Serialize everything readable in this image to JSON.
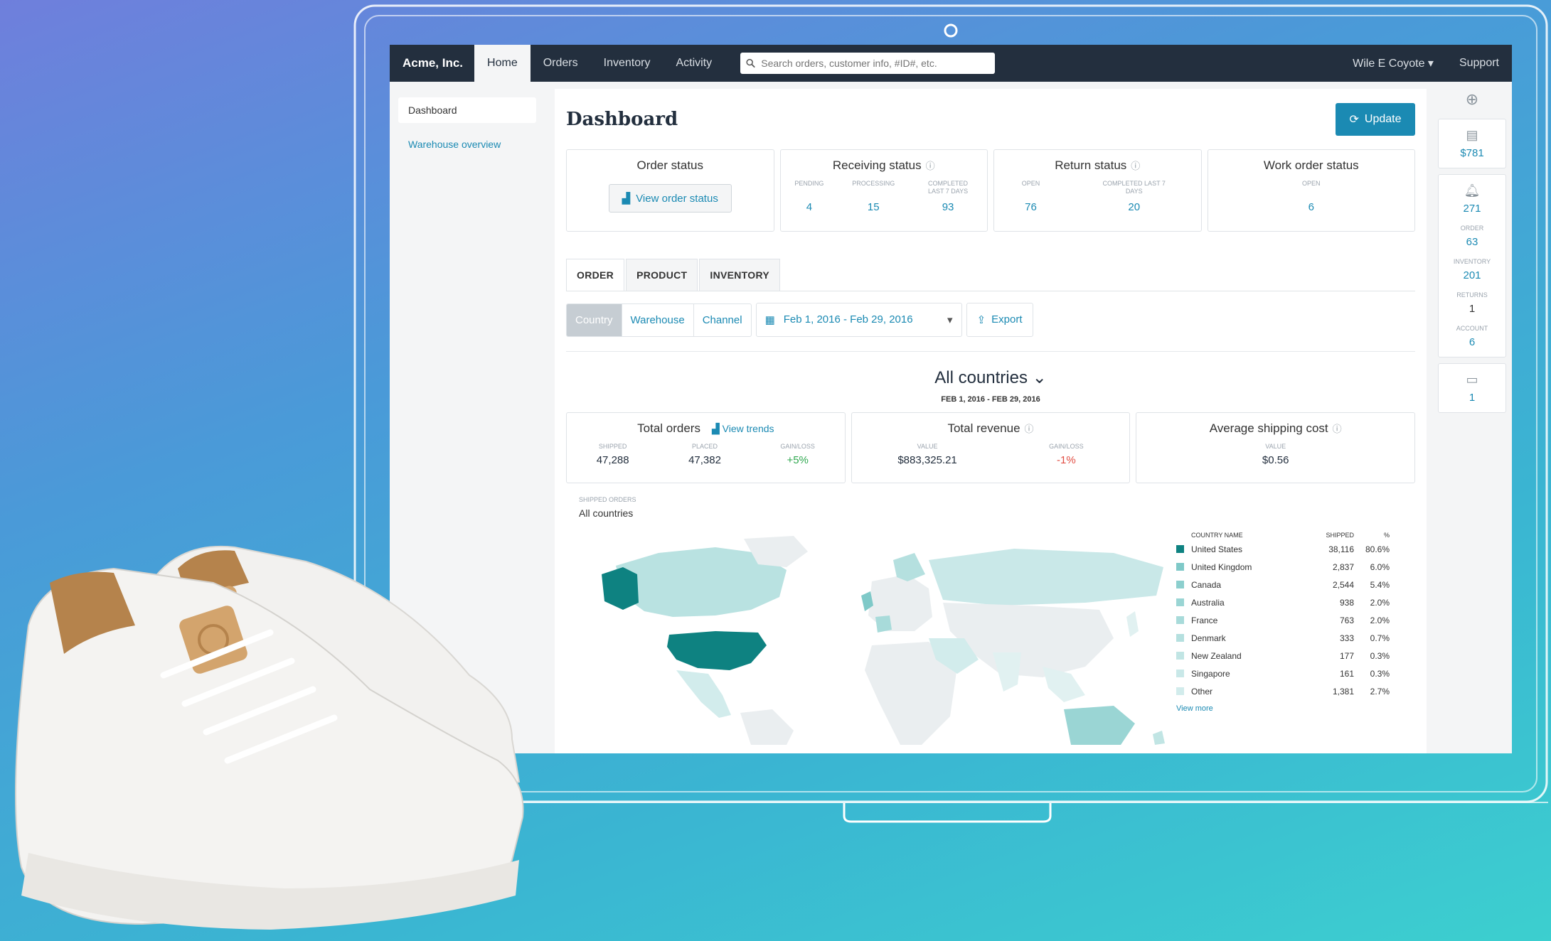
{
  "topnav": {
    "brand": "Acme, Inc.",
    "tabs": [
      "Home",
      "Orders",
      "Inventory",
      "Activity"
    ],
    "active_tab": "Home",
    "search_placeholder": "Search orders, customer info, #ID#, etc.",
    "user": "Wile E Coyote ▾",
    "support": "Support"
  },
  "sidebar": {
    "items": [
      {
        "label": "Dashboard",
        "active": true
      },
      {
        "label": "Warehouse overview",
        "active": false
      }
    ]
  },
  "page": {
    "title": "Dashboard",
    "update_label": "Update"
  },
  "status_cards": {
    "order": {
      "title": "Order status",
      "button": "View order status"
    },
    "receiving": {
      "title": "Receiving status",
      "metrics": [
        {
          "label": "Pending",
          "value": "4"
        },
        {
          "label": "Processing",
          "value": "15"
        },
        {
          "label": "Completed last 7 days",
          "value": "93"
        }
      ]
    },
    "return": {
      "title": "Return status",
      "metrics": [
        {
          "label": "Open",
          "value": "76"
        },
        {
          "label": "Completed last 7 days",
          "value": "20"
        }
      ]
    },
    "work_order": {
      "title": "Work order status",
      "metrics": [
        {
          "label": "Open",
          "value": "6"
        }
      ]
    }
  },
  "tabs": [
    "ORDER",
    "PRODUCT",
    "INVENTORY"
  ],
  "filters": {
    "segments": [
      "Country",
      "Warehouse",
      "Channel"
    ],
    "active_segment": "Country",
    "date_range": "Feb 1, 2016 - Feb 29, 2016",
    "export_label": "Export"
  },
  "country_header": {
    "selected": "All countries ⌄",
    "date_range": "FEB 1, 2016 - FEB 29, 2016"
  },
  "kpis": {
    "total_orders": {
      "title": "Total orders",
      "trend_link": "View trends",
      "metrics": [
        {
          "label": "Shipped",
          "value": "47,288",
          "tone": "neutral"
        },
        {
          "label": "Placed",
          "value": "47,382",
          "tone": "neutral"
        },
        {
          "label": "Gain/Loss",
          "value": "+5%",
          "tone": "pos"
        }
      ]
    },
    "total_revenue": {
      "title": "Total revenue",
      "metrics": [
        {
          "label": "Value",
          "value": "$883,325.21",
          "tone": "neutral"
        },
        {
          "label": "Gain/Loss",
          "value": "-1%",
          "tone": "neg"
        }
      ]
    },
    "avg_shipping": {
      "title": "Average shipping cost",
      "metrics": [
        {
          "label": "Value",
          "value": "$0.56",
          "tone": "neutral"
        }
      ]
    }
  },
  "map_section": {
    "sublabel": "Shipped orders",
    "country": "All countries",
    "legend_headers": [
      "Country name",
      "Shipped",
      "%"
    ],
    "legend": [
      {
        "name": "United States",
        "shipped": "38,116",
        "pct": "80.6%",
        "color": "#0e8281"
      },
      {
        "name": "United Kingdom",
        "shipped": "2,837",
        "pct": "6.0%",
        "color": "#7fc9c8"
      },
      {
        "name": "Canada",
        "shipped": "2,544",
        "pct": "5.4%",
        "color": "#8ccfce"
      },
      {
        "name": "Australia",
        "shipped": "938",
        "pct": "2.0%",
        "color": "#9ad5d4"
      },
      {
        "name": "France",
        "shipped": "763",
        "pct": "2.0%",
        "color": "#a8dbda"
      },
      {
        "name": "Denmark",
        "shipped": "333",
        "pct": "0.7%",
        "color": "#b5e0df"
      },
      {
        "name": "New Zealand",
        "shipped": "177",
        "pct": "0.3%",
        "color": "#c1e5e4"
      },
      {
        "name": "Singapore",
        "shipped": "161",
        "pct": "0.3%",
        "color": "#c9e8e8"
      },
      {
        "name": "Other",
        "shipped": "1,381",
        "pct": "2.7%",
        "color": "#d2ecec"
      }
    ],
    "more_link": "View more"
  },
  "right_rail": {
    "wallet": "$781",
    "notifications": "271",
    "breakdown": [
      {
        "label": "Order",
        "value": "63"
      },
      {
        "label": "Inventory",
        "value": "201"
      },
      {
        "label": "Returns",
        "value": "1"
      },
      {
        "label": "Account",
        "value": "6"
      }
    ],
    "messages": "1"
  }
}
